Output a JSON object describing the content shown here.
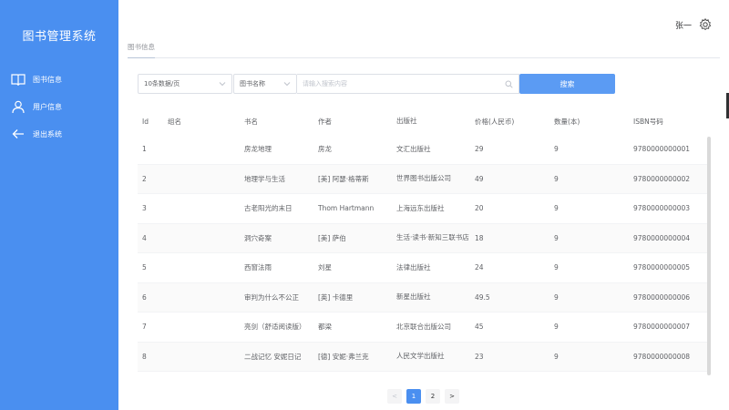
{
  "app": {
    "title": "图书管理系统"
  },
  "sidebar": {
    "items": [
      {
        "label": "图书信息",
        "icon": "book-icon"
      },
      {
        "label": "用户信息",
        "icon": "user-icon"
      },
      {
        "label": "退出系统",
        "icon": "arrow-left-icon"
      }
    ]
  },
  "header": {
    "username": "张一",
    "settings_icon": "gear-icon"
  },
  "tabs": [
    {
      "label": "图书信息",
      "active": true
    }
  ],
  "search": {
    "page_size": "10条数据/页",
    "field": "图书名称",
    "placeholder": "请输入搜索内容",
    "button": "搜索"
  },
  "table": {
    "headers": {
      "id": "Id",
      "group": "组名",
      "name": "书名",
      "author": "作者",
      "publisher": "出版社",
      "price": "价格(人民币)",
      "qty": "数量(本)",
      "isbn": "ISBN号码"
    },
    "rows": [
      {
        "id": "1",
        "group": "",
        "name": "房龙地理",
        "author": "房龙",
        "publisher": "文汇出版社",
        "price": "29",
        "qty": "9",
        "isbn": "9780000000001"
      },
      {
        "id": "2",
        "group": "",
        "name": "地理学与生活",
        "author": "[美] 阿瑟·格蒂斯",
        "publisher": "世界图书出版公司",
        "price": "49",
        "qty": "9",
        "isbn": "9780000000002"
      },
      {
        "id": "3",
        "group": "",
        "name": "古老阳光的末日",
        "author": "Thom Hartmann",
        "publisher": "上海远东出版社",
        "price": "20",
        "qty": "9",
        "isbn": "9780000000003"
      },
      {
        "id": "4",
        "group": "",
        "name": "洞穴奇案",
        "author": "[美] 萨伯",
        "publisher": "生活·读书·新知三联书店",
        "price": "18",
        "qty": "9",
        "isbn": "9780000000004"
      },
      {
        "id": "5",
        "group": "",
        "name": "西窗法雨",
        "author": "刘星",
        "publisher": "法律出版社",
        "price": "24",
        "qty": "9",
        "isbn": "9780000000005"
      },
      {
        "id": "6",
        "group": "",
        "name": "审判为什么不公正",
        "author": "[英] 卡德里",
        "publisher": "新星出版社",
        "price": "49.5",
        "qty": "9",
        "isbn": "9780000000006"
      },
      {
        "id": "7",
        "group": "",
        "name": "亮剑（舒适阅读版）",
        "author": "都梁",
        "publisher": "北京联合出版公司",
        "price": "45",
        "qty": "9",
        "isbn": "9780000000007"
      },
      {
        "id": "8",
        "group": "",
        "name": "二战记忆 安妮日记",
        "author": "[德] 安妮·弗兰克",
        "publisher": "人民文学出版社",
        "price": "23",
        "qty": "9",
        "isbn": "9780000000008"
      }
    ]
  },
  "pagination": {
    "prev": "<",
    "pages": [
      "1",
      "2"
    ],
    "current": "1",
    "next": ">"
  },
  "colors": {
    "sidebar": "#4a8ff0",
    "button": "#5b9bf3",
    "active_page": "#4a8ff0"
  }
}
